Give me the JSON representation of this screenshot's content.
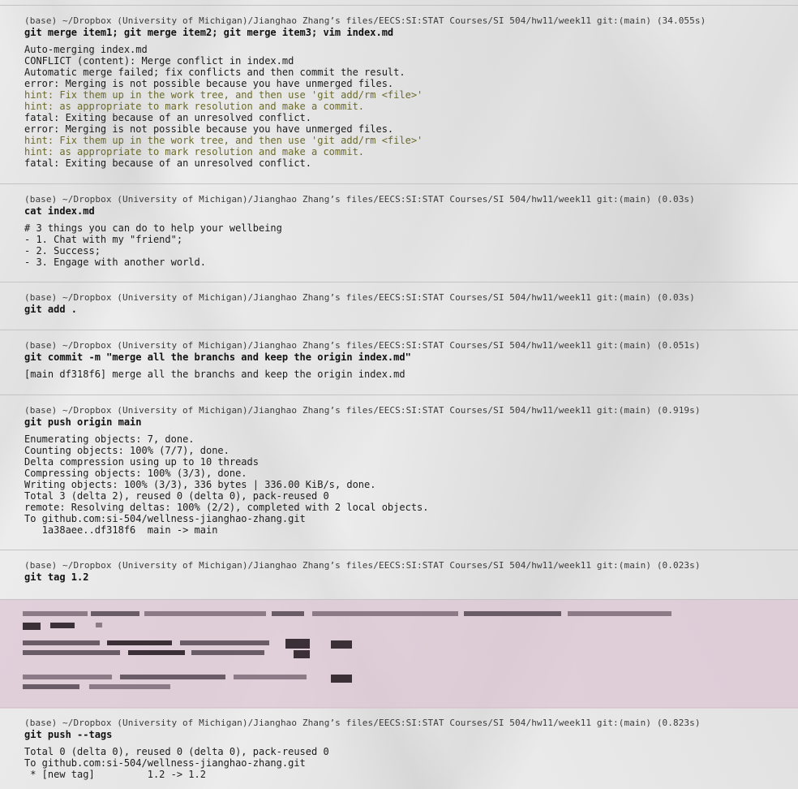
{
  "blocks": [
    {
      "prompt": "(base) ~/Dropbox (University of Michigan)/Jianghao Zhang’s files/EECS:SI:STAT Courses/SI 504/hw11/week11 git:(main) (34.055s)",
      "command": "git merge item1; git merge item2; git merge item3; vim index.md",
      "output": [
        {
          "text": "Auto-merging index.md",
          "hint": false
        },
        {
          "text": "CONFLICT (content): Merge conflict in index.md",
          "hint": false
        },
        {
          "text": "Automatic merge failed; fix conflicts and then commit the result.",
          "hint": false
        },
        {
          "text": "error: Merging is not possible because you have unmerged files.",
          "hint": false
        },
        {
          "text": "hint: Fix them up in the work tree, and then use 'git add/rm <file>'",
          "hint": true
        },
        {
          "text": "hint: as appropriate to mark resolution and make a commit.",
          "hint": true
        },
        {
          "text": "fatal: Exiting because of an unresolved conflict.",
          "hint": false
        },
        {
          "text": "error: Merging is not possible because you have unmerged files.",
          "hint": false
        },
        {
          "text": "hint: Fix them up in the work tree, and then use 'git add/rm <file>'",
          "hint": true
        },
        {
          "text": "hint: as appropriate to mark resolution and make a commit.",
          "hint": true
        },
        {
          "text": "fatal: Exiting because of an unresolved conflict.",
          "hint": false
        }
      ]
    },
    {
      "prompt": "(base) ~/Dropbox (University of Michigan)/Jianghao Zhang’s files/EECS:SI:STAT Courses/SI 504/hw11/week11 git:(main) (0.03s)",
      "command": "cat index.md",
      "output": [
        {
          "text": "# 3 things you can do to help your wellbeing",
          "hint": false
        },
        {
          "text": "- 1. Chat with my \"friend\";",
          "hint": false
        },
        {
          "text": "- 2. Success;",
          "hint": false
        },
        {
          "text": "- 3. Engage with another world.",
          "hint": false
        }
      ]
    },
    {
      "prompt": "(base) ~/Dropbox (University of Michigan)/Jianghao Zhang’s files/EECS:SI:STAT Courses/SI 504/hw11/week11 git:(main) (0.03s)",
      "command": "git add .",
      "output": []
    },
    {
      "prompt": "(base) ~/Dropbox (University of Michigan)/Jianghao Zhang’s files/EECS:SI:STAT Courses/SI 504/hw11/week11 git:(main) (0.051s)",
      "command": "git commit -m \"merge all the branchs and keep the origin index.md\"",
      "output": [
        {
          "text": "[main df318f6] merge all the branchs and keep the origin index.md",
          "hint": false
        }
      ]
    },
    {
      "prompt": "(base) ~/Dropbox (University of Michigan)/Jianghao Zhang’s files/EECS:SI:STAT Courses/SI 504/hw11/week11 git:(main) (0.919s)",
      "command": "git push origin main",
      "output": [
        {
          "text": "Enumerating objects: 7, done.",
          "hint": false
        },
        {
          "text": "Counting objects: 100% (7/7), done.",
          "hint": false
        },
        {
          "text": "Delta compression using up to 10 threads",
          "hint": false
        },
        {
          "text": "Compressing objects: 100% (3/3), done.",
          "hint": false
        },
        {
          "text": "Writing objects: 100% (3/3), 336 bytes | 336.00 KiB/s, done.",
          "hint": false
        },
        {
          "text": "Total 3 (delta 2), reused 0 (delta 0), pack-reused 0",
          "hint": false
        },
        {
          "text": "remote: Resolving deltas: 100% (2/2), completed with 2 local objects.",
          "hint": false
        },
        {
          "text": "To github.com:si-504/wellness-jianghao-zhang.git",
          "hint": false
        },
        {
          "text": "   1a38aee..df318f6  main -> main",
          "hint": false
        }
      ]
    },
    {
      "prompt": "(base) ~/Dropbox (University of Michigan)/Jianghao Zhang’s files/EECS:SI:STAT Courses/SI 504/hw11/week11 git:(main) (0.023s)",
      "command": "git tag 1.2",
      "output": []
    },
    {
      "prompt": "(base) ~/Dropbox (University of Michigan)/Jianghao Zhang’s files/EECS:SI:STAT Courses/SI 504/hw11/week11 git:(main) (0.823s)",
      "command": "git push --tags",
      "output": [
        {
          "text": "Total 0 (delta 0), reused 0 (delta 0), pack-reused 0",
          "hint": false
        },
        {
          "text": "To github.com:si-504/wellness-jianghao-zhang.git",
          "hint": false
        },
        {
          "text": " * [new tag]         1.2 -> 1.2",
          "hint": false
        }
      ]
    }
  ]
}
